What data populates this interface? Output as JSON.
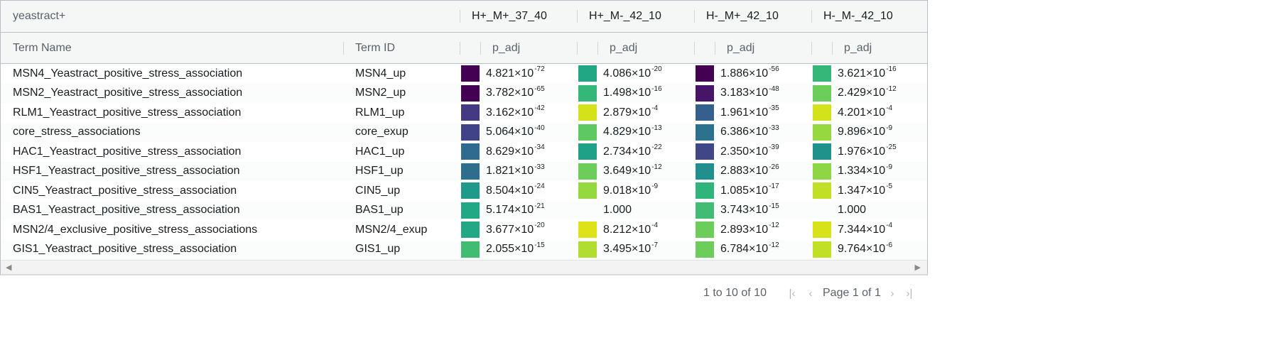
{
  "header": {
    "group_label": "yeastract+",
    "groups": [
      "H+_M+_37_40",
      "H+_M-_42_10",
      "H-_M+_42_10",
      "H-_M-_42_10"
    ],
    "columns": {
      "term_name": "Term Name",
      "term_id": "Term ID",
      "metric": "p_adj"
    }
  },
  "rows": [
    {
      "name": "MSN4_Yeastract_positive_stress_association",
      "id": "MSN4_up",
      "cells": [
        {
          "m": "4.821",
          "e": "-72",
          "c": "#440154"
        },
        {
          "m": "4.086",
          "e": "-20",
          "c": "#22a784"
        },
        {
          "m": "1.886",
          "e": "-56",
          "c": "#440154"
        },
        {
          "m": "3.621",
          "e": "-16",
          "c": "#35b779"
        }
      ]
    },
    {
      "name": "MSN2_Yeastract_positive_stress_association",
      "id": "MSN2_up",
      "cells": [
        {
          "m": "3.782",
          "e": "-65",
          "c": "#440154"
        },
        {
          "m": "1.498",
          "e": "-16",
          "c": "#35b779"
        },
        {
          "m": "3.183",
          "e": "-48",
          "c": "#481467"
        },
        {
          "m": "2.429",
          "e": "-12",
          "c": "#6ccd5a"
        }
      ]
    },
    {
      "name": "RLM1_Yeastract_positive_stress_association",
      "id": "RLM1_up",
      "cells": [
        {
          "m": "3.162",
          "e": "-42",
          "c": "#443a83"
        },
        {
          "m": "2.879",
          "e": "-4",
          "c": "#d5e21a"
        },
        {
          "m": "1.961",
          "e": "-35",
          "c": "#355f8d"
        },
        {
          "m": "4.201",
          "e": "-4",
          "c": "#d2e21b"
        }
      ]
    },
    {
      "name": "core_stress_associations",
      "id": "core_exup",
      "cells": [
        {
          "m": "5.064",
          "e": "-40",
          "c": "#404387"
        },
        {
          "m": "4.829",
          "e": "-13",
          "c": "#5ec962"
        },
        {
          "m": "6.386",
          "e": "-33",
          "c": "#2c728e"
        },
        {
          "m": "9.896",
          "e": "-9",
          "c": "#95d840"
        }
      ]
    },
    {
      "name": "HAC1_Yeastract_positive_stress_association",
      "id": "HAC1_up",
      "cells": [
        {
          "m": "8.629",
          "e": "-34",
          "c": "#2f6b8e"
        },
        {
          "m": "2.734",
          "e": "-22",
          "c": "#1fa187"
        },
        {
          "m": "2.350",
          "e": "-39",
          "c": "#3f4788"
        },
        {
          "m": "1.976",
          "e": "-25",
          "c": "#20928c"
        }
      ]
    },
    {
      "name": "HSF1_Yeastract_positive_stress_association",
      "id": "HSF1_up",
      "cells": [
        {
          "m": "1.821",
          "e": "-33",
          "c": "#2d6e8e"
        },
        {
          "m": "3.649",
          "e": "-12",
          "c": "#6ccd5a"
        },
        {
          "m": "2.883",
          "e": "-26",
          "c": "#218f8d"
        },
        {
          "m": "1.334",
          "e": "-9",
          "c": "#8ed645"
        }
      ]
    },
    {
      "name": "CIN5_Yeastract_positive_stress_association",
      "id": "CIN5_up",
      "cells": [
        {
          "m": "8.504",
          "e": "-24",
          "c": "#1f9a8a"
        },
        {
          "m": "9.018",
          "e": "-9",
          "c": "#95d840"
        },
        {
          "m": "1.085",
          "e": "-17",
          "c": "#2fb47c"
        },
        {
          "m": "1.347",
          "e": "-5",
          "c": "#c0df25"
        }
      ]
    },
    {
      "name": "BAS1_Yeastract_positive_stress_association",
      "id": "BAS1_up",
      "cells": [
        {
          "m": "5.174",
          "e": "-21",
          "c": "#22a884"
        },
        {
          "m": "1.000",
          "e": "",
          "c": ""
        },
        {
          "m": "3.743",
          "e": "-15",
          "c": "#40bd72"
        },
        {
          "m": "1.000",
          "e": "",
          "c": ""
        }
      ]
    },
    {
      "name": "MSN2/4_exclusive_positive_stress_associations",
      "id": "MSN2/4_exup",
      "cells": [
        {
          "m": "3.677",
          "e": "-20",
          "c": "#22a884"
        },
        {
          "m": "8.212",
          "e": "-4",
          "c": "#dde318"
        },
        {
          "m": "2.893",
          "e": "-12",
          "c": "#6ccd5a"
        },
        {
          "m": "7.344",
          "e": "-4",
          "c": "#d8e219"
        }
      ]
    },
    {
      "name": "GIS1_Yeastract_positive_stress_association",
      "id": "GIS1_up",
      "cells": [
        {
          "m": "2.055",
          "e": "-15",
          "c": "#40bd72"
        },
        {
          "m": "3.495",
          "e": "-7",
          "c": "#b0dd2f"
        },
        {
          "m": "6.784",
          "e": "-12",
          "c": "#6ccd5a"
        },
        {
          "m": "9.764",
          "e": "-6",
          "c": "#c0df25"
        }
      ]
    }
  ],
  "pagination": {
    "summary": "1 to 10 of 10",
    "page_label": "Page 1 of 1"
  },
  "times_symbol": "×10"
}
